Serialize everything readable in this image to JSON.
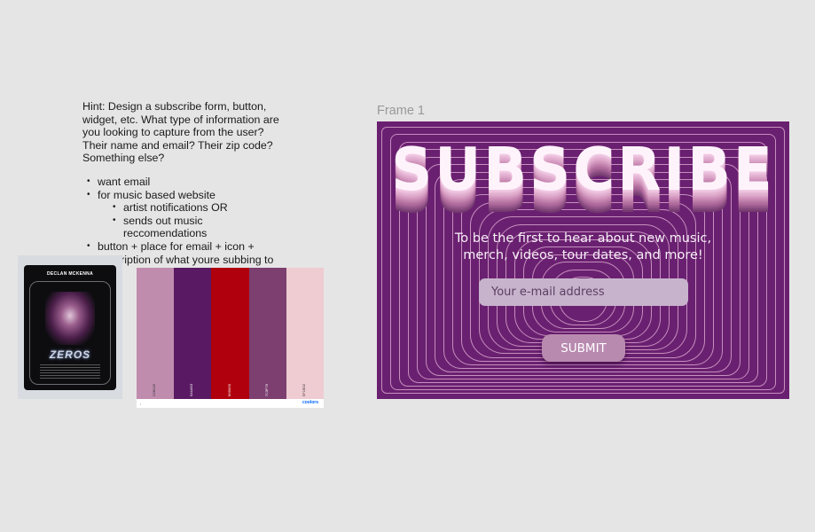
{
  "hint": {
    "paragraph": "Hint: Design a subscribe form, button, widget, etc. What type of information are you looking to capture from the user? Their name and email? Their zip code? Something else?",
    "bullets": [
      "want email",
      "for music based website",
      "button + place for email + icon + description of what youre subbing to"
    ],
    "sub_bullets": [
      "artist notifications OR",
      "sends out music reccomendations"
    ]
  },
  "poster": {
    "artist": "DECLAN MCKENNA",
    "title": "ZEROS"
  },
  "palette": {
    "colors": [
      "#C08CAE",
      "#5A1A63",
      "#B0000D",
      "#7C3F70",
      "#EFCBD2"
    ],
    "labels": [
      "C08CAE",
      "5A1A63",
      "B0000D",
      "7C3F70",
      "EFCBD2"
    ],
    "label_colors": [
      "#333333",
      "#ffffff",
      "#ffffff",
      "#ffffff",
      "#333333"
    ],
    "brand": "coolors",
    "dot": "•"
  },
  "frame": {
    "label": "Frame 1",
    "background": "#6a2070",
    "title": "SUBSCRIBE",
    "tagline_line1": "To be the first to hear about new music,",
    "tagline_line2": "merch, videos, tour dates, and more!",
    "email_placeholder": "Your e-mail address",
    "submit_label": "SUBMIT"
  }
}
